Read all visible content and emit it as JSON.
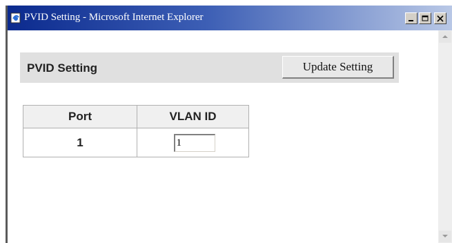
{
  "window": {
    "title": "PVID Setting - Microsoft Internet Explorer"
  },
  "page": {
    "title": "PVID Setting",
    "update_button_label": "Update Setting"
  },
  "table": {
    "headers": [
      "Port",
      "VLAN ID"
    ],
    "rows": [
      {
        "port": "1",
        "vlan_id": "1"
      }
    ]
  },
  "colors": {
    "titlebar_start": "#0b2a8e",
    "titlebar_end": "#b9c8e6",
    "header_bar": "#e0e0e0"
  },
  "icons": [
    "ie-page-icon",
    "minimize-icon",
    "maximize-icon",
    "close-icon",
    "scroll-up-icon",
    "scroll-down-icon"
  ]
}
